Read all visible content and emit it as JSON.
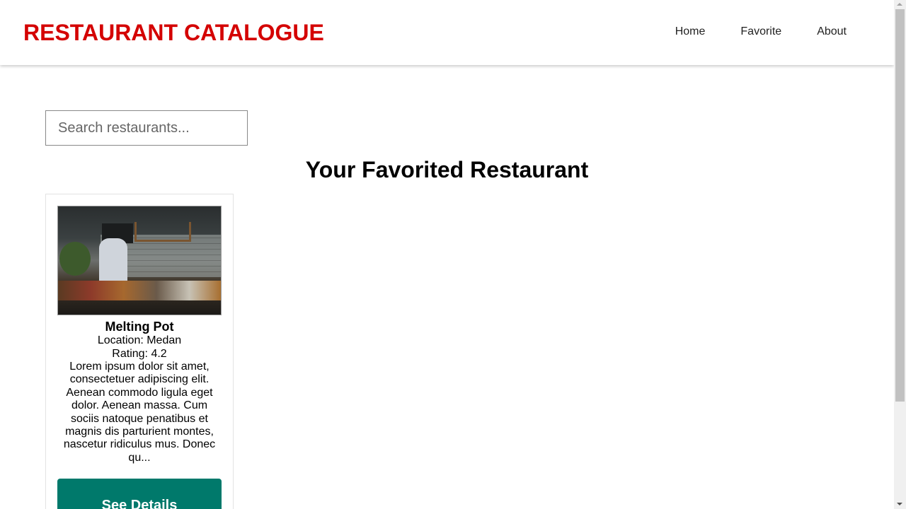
{
  "header": {
    "title": "RESTAURANT CATALOGUE",
    "nav": [
      "Home",
      "Favorite",
      "About"
    ]
  },
  "search": {
    "placeholder": "Search restaurants..."
  },
  "main": {
    "heading": "Your Favorited Restaurant"
  },
  "restaurants": [
    {
      "name": "Melting Pot",
      "location": "Location: Medan",
      "rating": "Rating: 4.2",
      "description": "Lorem ipsum dolor sit amet, consectetuer adipiscing elit. Aenean commodo ligula eget dolor. Aenean massa. Cum sociis natoque penatibus et magnis dis parturient montes, nascetur ridiculus mus. Donec qu...",
      "button": "See Details"
    }
  ],
  "colors": {
    "brand": "#d40000",
    "button": "#00796b"
  }
}
